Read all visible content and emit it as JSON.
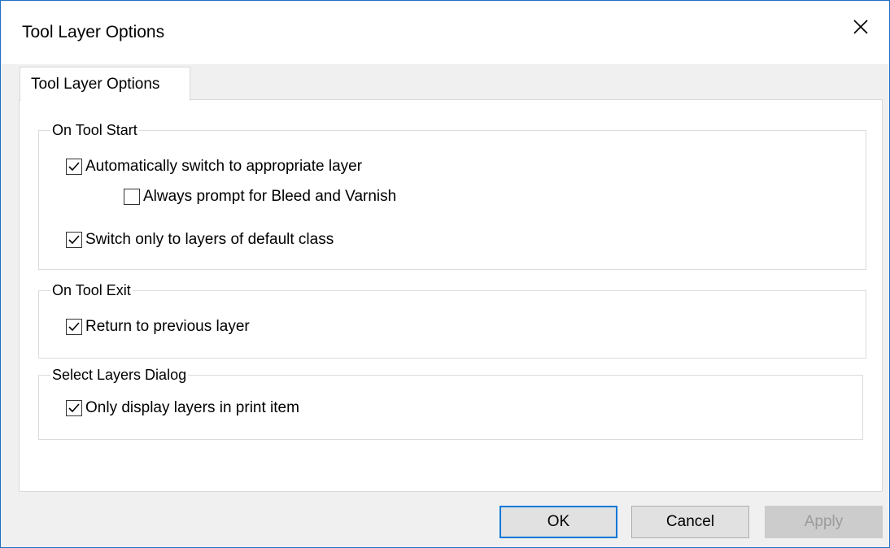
{
  "window": {
    "title": "Tool Layer Options",
    "close_icon": "close-icon"
  },
  "tabs": [
    {
      "label": "Tool Layer Options",
      "selected": true
    }
  ],
  "groups": {
    "on_tool_start": {
      "title": "On Tool Start",
      "auto_switch": {
        "label": "Automatically switch to appropriate layer",
        "checked": true
      },
      "prompt_bleed": {
        "label": "Always prompt for Bleed and Varnish",
        "checked": false
      },
      "default_class": {
        "label": "Switch only to layers of default class",
        "checked": true
      }
    },
    "on_tool_exit": {
      "title": "On Tool Exit",
      "return_previous": {
        "label": "Return to previous layer",
        "checked": true
      }
    },
    "select_layers_dialog": {
      "title": "Select Layers Dialog",
      "only_print_item": {
        "label": "Only display layers in print item",
        "checked": true
      }
    }
  },
  "buttons": {
    "ok": "OK",
    "cancel": "Cancel",
    "apply": "Apply"
  },
  "colors": {
    "accent": "#0078d7",
    "border": "#1f6fc4",
    "disabled_text": "#9b9b9b"
  }
}
